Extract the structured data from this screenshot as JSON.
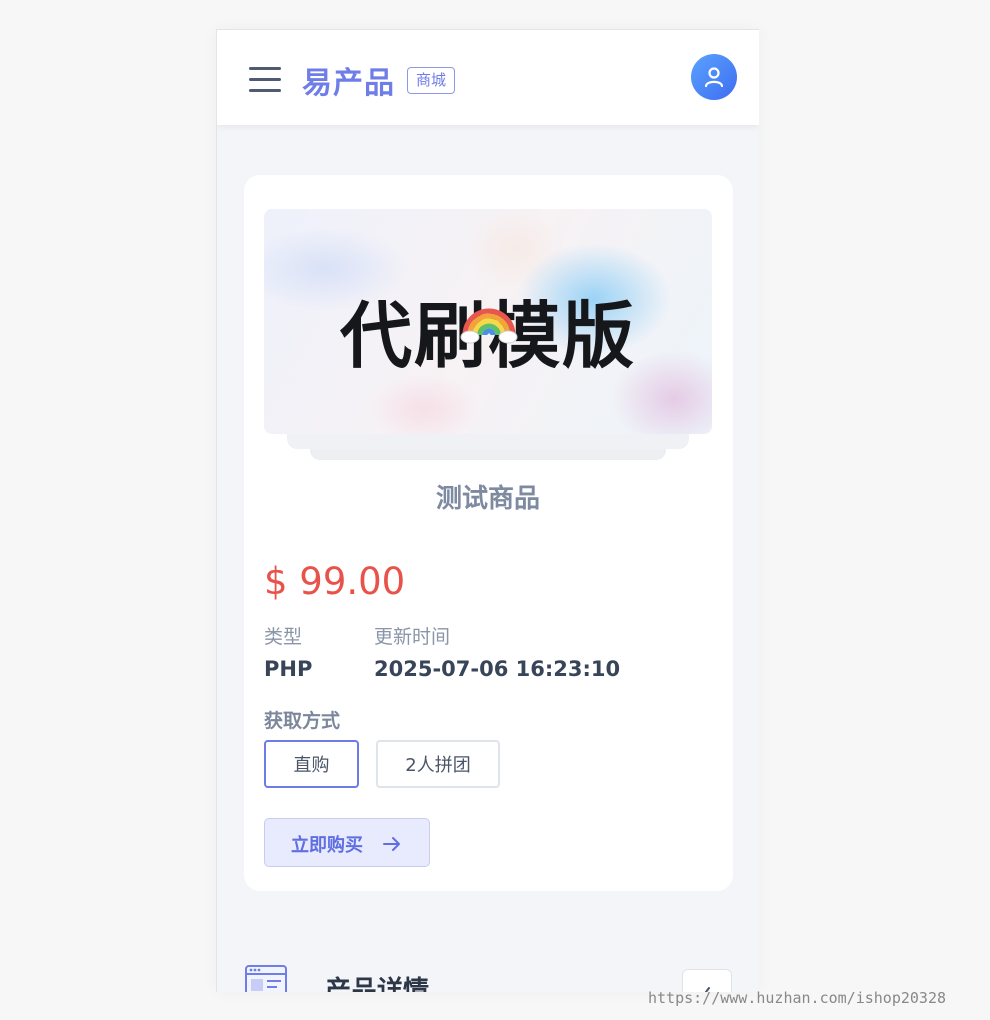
{
  "header": {
    "brand": "易产品",
    "badge": "商城",
    "menu_icon": "hamburger-menu-icon",
    "avatar_icon": "user-icon",
    "accent": "#6f7de8"
  },
  "product": {
    "image_title": "代刷模版",
    "name": "测试商品",
    "price": "$ 99.00",
    "price_color": "#e8524a",
    "type_label": "类型",
    "type_value": "PHP",
    "updated_label": "更新时间",
    "updated_value": "2025-07-06 16:23:10"
  },
  "purchase": {
    "method_label": "获取方式",
    "options": [
      {
        "label": "直购",
        "selected": true
      },
      {
        "label": "2人拼团",
        "selected": false
      }
    ],
    "buy_label": "立即购买",
    "buy_icon": "arrow-right-icon"
  },
  "detail": {
    "title": "产品详情",
    "icon": "product-detail-icon",
    "toggle_icon": "chevron-icon"
  },
  "watermark": "https://www.huzhan.com/ishop20328"
}
